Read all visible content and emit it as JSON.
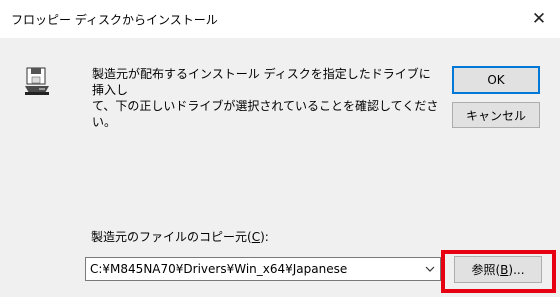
{
  "window": {
    "title": "フロッピー ディスクからインストール",
    "close_glyph": "✕"
  },
  "message": {
    "line1": "製造元が配布するインストール ディスクを指定したドライブに挿入し",
    "line2": "て、下の正しいドライブが選択されていることを確認してください。"
  },
  "buttons": {
    "ok_label": "OK",
    "cancel_label": "キャンセル",
    "browse_prefix": "参照(",
    "browse_key": "B",
    "browse_suffix": ")..."
  },
  "copy_from": {
    "label_prefix": "製造元のファイルのコピー元(",
    "label_key": "C",
    "label_suffix": "):",
    "value": "C:¥M845NA70¥Drivers¥Win_x64¥Japanese"
  },
  "icons": {
    "disk": "floppy-drive-icon",
    "dropdown": "chevron-down-icon"
  },
  "colors": {
    "highlight_border": "#e60012",
    "default_button_border": "#0078d7",
    "dialog_background": "#f0f0f0"
  }
}
